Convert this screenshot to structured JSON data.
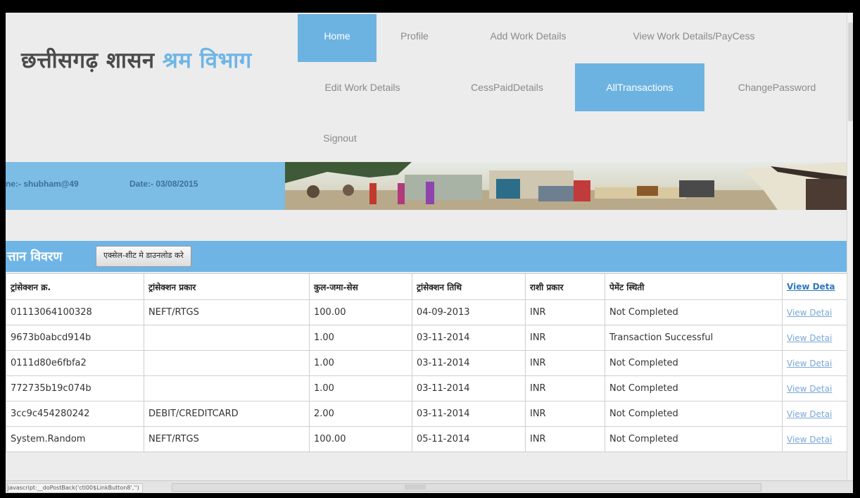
{
  "header": {
    "title_part1": "छत्तीसगढ़ शासन",
    "title_part2": "श्रम विभाग"
  },
  "nav": [
    {
      "label": "Home",
      "active": true
    },
    {
      "label": "Profile",
      "active": false
    },
    {
      "label": "Add Work Details",
      "active": false
    },
    {
      "label": "View Work Details/PayCess",
      "active": false
    },
    {
      "label": "Edit Work Details",
      "active": false
    },
    {
      "label": "CessPaidDetails",
      "active": false
    },
    {
      "label": "AllTransactions",
      "active": true
    },
    {
      "label": "ChangePassword",
      "active": false
    },
    {
      "label": "Signout",
      "active": false
    }
  ],
  "info_bar": {
    "user": "ne:- shubham@49",
    "date": "Date:- 03/08/2015"
  },
  "section": {
    "title": "त्तान विवरण",
    "download_label": "एक्सेल-शीट मे डाउनलोड करे"
  },
  "table": {
    "headers": [
      "ट्रांसेक्शन क्र.",
      "ट्रांसेक्शन प्रकार",
      "कुल-जमा-सेस",
      "ट्रांसेक्शन तिथि",
      "राशी प्रकार",
      "पेमेंट स्थिती",
      "View Deta"
    ],
    "rows": [
      [
        "01113064100328",
        "NEFT/RTGS",
        "100.00",
        "04-09-2013",
        "INR",
        "Not Completed",
        "View Detai"
      ],
      [
        "9673b0abcd914b",
        "",
        "1.00",
        "03-11-2014",
        "INR",
        "Transaction Successful",
        "View Detai"
      ],
      [
        "0111d80e6fbfa2",
        "",
        "1.00",
        "03-11-2014",
        "INR",
        "Not Completed",
        "View Detai"
      ],
      [
        "772735b19c074b",
        "",
        "1.00",
        "03-11-2014",
        "INR",
        "Not Completed",
        "View Detai"
      ],
      [
        "3cc9c454280242",
        "DEBIT/CREDITCARD",
        "2.00",
        "03-11-2014",
        "INR",
        "Not Completed",
        "View Detai"
      ],
      [
        "System.Random",
        "NEFT/RTGS",
        "100.00",
        "05-11-2014",
        "INR",
        "Not Completed",
        "View Detai"
      ]
    ]
  },
  "status_bar": {
    "text": "javascript:__doPostBack('ctl00$LinkButton8','')"
  }
}
